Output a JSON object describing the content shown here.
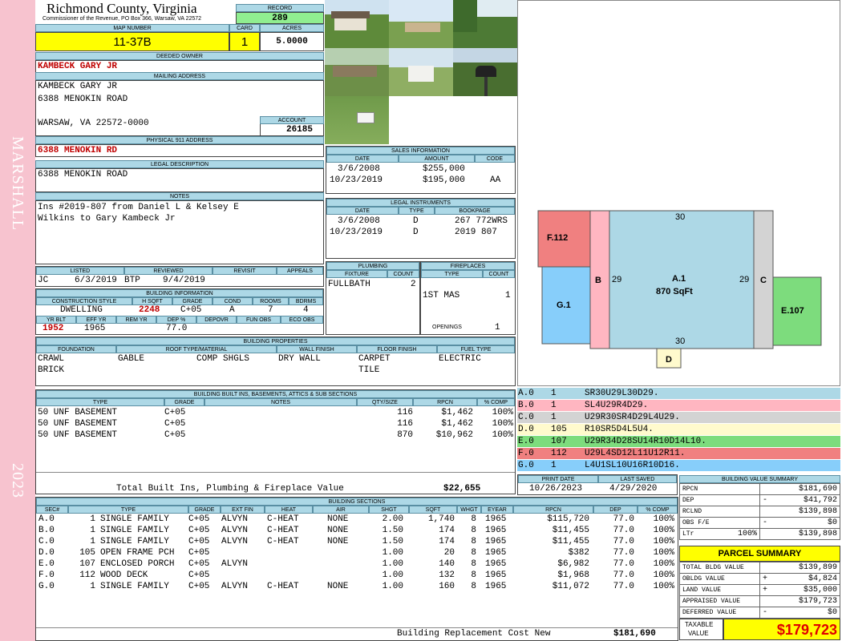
{
  "sidebar": {
    "name": "MARSHALL",
    "year": "2023"
  },
  "header": {
    "county": "Richmond County, Virginia",
    "address": "Commissioner of the Revenue, PO Box 366, Warsaw, VA 22572"
  },
  "record": {
    "label": "RECORD",
    "value": "289"
  },
  "map": {
    "label": "MAP NUMBER",
    "value": "11-37B"
  },
  "card": {
    "label": "CARD",
    "value": "1"
  },
  "acres": {
    "label": "ACRES",
    "value": "5.0000"
  },
  "deeded_owner": {
    "label": "DEEDED OWNER",
    "value": "KAMBECK GARY JR"
  },
  "mailing": {
    "label": "MAILING ADDRESS",
    "line1": "KAMBECK GARY JR",
    "line2": "6388 MENOKIN ROAD",
    "line3": "WARSAW, VA 22572-0000"
  },
  "account": {
    "label": "ACCOUNT",
    "value": "26185"
  },
  "physical": {
    "label": "PHYSICAL 911 ADDRESS",
    "value": "6388 MENOKIN RD"
  },
  "legal": {
    "label": "LEGAL DESCRIPTION",
    "value": "6388 MENOKIN ROAD"
  },
  "notes": {
    "label": "NOTES",
    "line1": "Ins #2019-807 from Daniel L & Kelsey E",
    "line2": "Wilkins to Gary Kambeck Jr"
  },
  "listing": {
    "h_listed": "LISTED",
    "h_reviewed": "REVIEWED",
    "h_revisit": "REVISIT",
    "h_appeals": "APPEALS",
    "listed_by": "JC",
    "listed_date": "6/3/2019",
    "reviewed_by": "BTP",
    "reviewed_date": "9/4/2019"
  },
  "building_info": {
    "label": "BUILDING INFORMATION",
    "h_style": "CONSTRUCTION STYLE",
    "h_hsqft": "H SQFT",
    "h_grade": "GRADE",
    "h_cond": "COND",
    "h_rooms": "ROOMS",
    "h_bdrms": "BDRMS",
    "style": "DWELLING",
    "hsqft": "2248",
    "grade": "C+05",
    "cond": "A",
    "rooms": "7",
    "bdrms": "4",
    "h_yrblt": "YR BLT",
    "h_effyr": "EFF YR",
    "h_remyr": "REM YR",
    "h_dep": "DEP %",
    "h_depovr": "DEPOVR",
    "h_funobs": "FUN OBS",
    "h_ecoobs": "ECO OBS",
    "yrblt": "1952",
    "effyr": "1965",
    "dep": "77.0"
  },
  "sales": {
    "label": "SALES INFORMATION",
    "h_date": "DATE",
    "h_amount": "AMOUNT",
    "h_code": "CODE",
    "rows": [
      {
        "date": "3/6/2008",
        "amount": "$255,000",
        "code": ""
      },
      {
        "date": "10/23/2019",
        "amount": "$195,000",
        "code": "AA"
      }
    ]
  },
  "instruments": {
    "label": "LEGAL INSTRUMENTS",
    "h_date": "DATE",
    "h_type": "TYPE",
    "h_book": "BOOKPAGE",
    "rows": [
      {
        "date": "3/6/2008",
        "type": "D",
        "book": "267 772WRS"
      },
      {
        "date": "10/23/2019",
        "type": "D",
        "book": "2019 807"
      }
    ]
  },
  "plumbing": {
    "label": "PLUMBING",
    "h_fixture": "FIXTURE",
    "h_count": "COUNT",
    "fixture": "FULLBATH",
    "count": "2"
  },
  "fireplaces": {
    "label": "FIREPLACES",
    "h_type": "TYPE",
    "h_count": "COUNT",
    "type": "1ST MAS",
    "count": "1",
    "h_openings": "OPENINGS",
    "openings": "1"
  },
  "properties": {
    "label": "BUILDING PROPERTIES",
    "h_foundation": "FOUNDATION",
    "h_roof": "ROOF TYPE/MATERIAL",
    "h_wall": "WALL FINISH",
    "h_floor": "FLOOR FINISH",
    "h_fuel": "FUEL TYPE",
    "foundation1": "CRAWL",
    "foundation2": "BRICK",
    "roof1": "GABLE",
    "roof2": "COMP SHGLS",
    "wall": "DRY WALL",
    "floor1": "CARPET",
    "floor2": "TILE",
    "fuel": "ELECTRIC"
  },
  "builtins": {
    "label": "BUILDING BUILT INS, BASEMENTS, ATTICS & SUB SECTIONS",
    "h_type": "TYPE",
    "h_grade": "GRADE",
    "h_notes": "NOTES",
    "h_qty": "QTY/SIZE",
    "h_rpcn": "RPCN",
    "h_comp": "% COMP",
    "rows": [
      {
        "type": "50 UNF BASEMENT",
        "grade": "C+05",
        "qty": "116",
        "rpcn": "$1,462",
        "comp": "100%"
      },
      {
        "type": "50 UNF BASEMENT",
        "grade": "C+05",
        "qty": "116",
        "rpcn": "$1,462",
        "comp": "100%"
      },
      {
        "type": "50 UNF BASEMENT",
        "grade": "C+05",
        "qty": "870",
        "rpcn": "$10,962",
        "comp": "100%"
      }
    ],
    "total_label": "Total Built Ins, Plumbing & Fireplace Value",
    "total": "$22,655"
  },
  "dates": {
    "h_print": "PRINT DATE",
    "h_saved": "LAST SAVED",
    "print": "10/26/2023",
    "saved": "4/29/2020"
  },
  "sections": {
    "label": "BUILDING SECTIONS",
    "h_sec": "SEC#",
    "h_type": "TYPE",
    "h_grade": "GRADE",
    "h_extfin": "EXT FIN",
    "h_heat": "HEAT",
    "h_air": "AIR",
    "h_shgt": "SHGT",
    "h_sqft": "SQFT",
    "h_whgt": "WHGT",
    "h_eyear": "EYEAR",
    "h_rpcn": "RPCN",
    "h_dep": "DEP",
    "h_comp": "% COMP",
    "rows": [
      {
        "sec": "A.0",
        "num": "1",
        "type": "SINGLE FAMILY",
        "grade": "C+05",
        "ext": "ALVYN",
        "heat": "C-HEAT",
        "air": "NONE",
        "shgt": "2.00",
        "sqft": "1,740",
        "whgt": "8",
        "eyear": "1965",
        "rpcn": "$115,720",
        "dep": "77.0",
        "comp": "100%"
      },
      {
        "sec": "B.0",
        "num": "1",
        "type": "SINGLE FAMILY",
        "grade": "C+05",
        "ext": "ALVYN",
        "heat": "C-HEAT",
        "air": "NONE",
        "shgt": "1.50",
        "sqft": "174",
        "whgt": "8",
        "eyear": "1965",
        "rpcn": "$11,455",
        "dep": "77.0",
        "comp": "100%"
      },
      {
        "sec": "C.0",
        "num": "1",
        "type": "SINGLE FAMILY",
        "grade": "C+05",
        "ext": "ALVYN",
        "heat": "C-HEAT",
        "air": "NONE",
        "shgt": "1.50",
        "sqft": "174",
        "whgt": "8",
        "eyear": "1965",
        "rpcn": "$11,455",
        "dep": "77.0",
        "comp": "100%"
      },
      {
        "sec": "D.0",
        "num": "105",
        "type": "OPEN FRAME PCH",
        "grade": "C+05",
        "ext": "",
        "heat": "",
        "air": "",
        "shgt": "1.00",
        "sqft": "20",
        "whgt": "8",
        "eyear": "1965",
        "rpcn": "$382",
        "dep": "77.0",
        "comp": "100%"
      },
      {
        "sec": "E.0",
        "num": "107",
        "type": "ENCLOSED PORCH",
        "grade": "C+05",
        "ext": "ALVYN",
        "heat": "",
        "air": "",
        "shgt": "1.00",
        "sqft": "140",
        "whgt": "8",
        "eyear": "1965",
        "rpcn": "$6,982",
        "dep": "77.0",
        "comp": "100%"
      },
      {
        "sec": "F.0",
        "num": "112",
        "type": "WOOD DECK",
        "grade": "C+05",
        "ext": "",
        "heat": "",
        "air": "",
        "shgt": "1.00",
        "sqft": "132",
        "whgt": "8",
        "eyear": "1965",
        "rpcn": "$1,968",
        "dep": "77.0",
        "comp": "100%"
      },
      {
        "sec": "G.0",
        "num": "1",
        "type": "SINGLE FAMILY",
        "grade": "C+05",
        "ext": "ALVYN",
        "heat": "C-HEAT",
        "air": "NONE",
        "shgt": "1.00",
        "sqft": "160",
        "whgt": "8",
        "eyear": "1965",
        "rpcn": "$11,072",
        "dep": "77.0",
        "comp": "100%"
      }
    ],
    "total_label": "Building Replacement Cost New",
    "total": "$181,690"
  },
  "sketch": {
    "A_label": "A.1",
    "A_area": "870 SqFt",
    "top": "30",
    "bottom": "30",
    "left": "29",
    "right": "29",
    "B": "B",
    "C": "C",
    "D": "D",
    "E": "E.107",
    "F": "F.112",
    "G": "G.1"
  },
  "sketch_codes": [
    {
      "sec": "A.0",
      "num": "1",
      "code": "SR30U29L30D29.",
      "color": "#add8e6"
    },
    {
      "sec": "B.0",
      "num": "1",
      "code": "SL4U29R4D29.",
      "color": "#ffb6c1"
    },
    {
      "sec": "C.0",
      "num": "1",
      "code": "U29R30SR4D29L4U29.",
      "color": "#d3d3d3"
    },
    {
      "sec": "D.0",
      "num": "105",
      "code": "R10SR5D4L5U4.",
      "color": "#fffacd"
    },
    {
      "sec": "E.0",
      "num": "107",
      "code": "U29R34D28SU14R10D14L10.",
      "color": "#7ddc7d"
    },
    {
      "sec": "F.0",
      "num": "112",
      "code": "U29L4SD12L11U12R11.",
      "color": "#f08080"
    },
    {
      "sec": "G.0",
      "num": "1",
      "code": "L4U1SL10U16R10D16.",
      "color": "#87cefa"
    }
  ],
  "value_summary": {
    "label": "BUILDING VALUE SUMMARY",
    "rpcn_l": "RPCN",
    "rpcn": "$181,690",
    "dep_l": "DEP",
    "dep_s": "-",
    "dep": "$41,792",
    "rclnd_l": "RCLND",
    "rclnd": "$139,898",
    "obs_l": "OBS F/E",
    "obs_s": "-",
    "obs": "$0",
    "ltr_l": "LTr",
    "ltr_pct": "100%",
    "ltr": "$139,898"
  },
  "parcel": {
    "label": "PARCEL SUMMARY",
    "tb_l": "TOTAL BLDG VALUE",
    "tb": "$139,899",
    "ob_l": "OBLDG VALUE",
    "ob_s": "+",
    "ob": "$4,824",
    "lv_l": "LAND VALUE",
    "lv_s": "+",
    "lv": "$35,000",
    "av_l": "APPRAISED VALUE",
    "av": "$179,723",
    "dv_l": "DEFERRED VALUE",
    "dv_s": "-",
    "dv": "$0",
    "tv_l1": "TAXABLE",
    "tv_l2": "VALUE",
    "tv": "$179,723"
  }
}
